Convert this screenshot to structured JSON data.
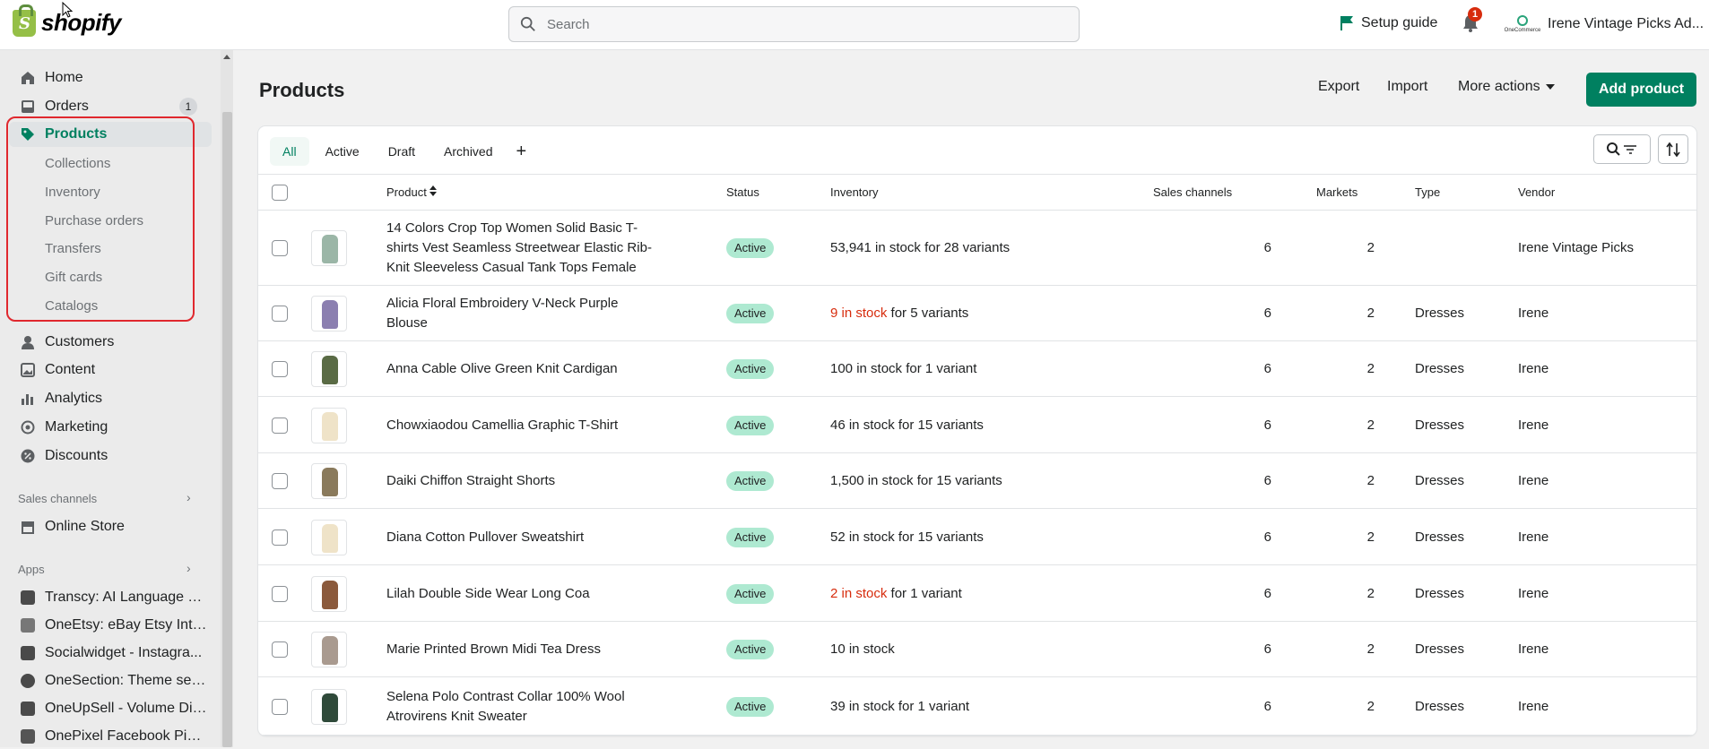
{
  "topbar": {
    "logo_text": "shopify",
    "search_placeholder": "Search",
    "setup_guide": "Setup guide",
    "notification_count": "1",
    "store_name": "Irene Vintage Picks Ad...",
    "store_logo_text": "OneCommerce"
  },
  "sidebar": {
    "home": "Home",
    "orders": "Orders",
    "orders_badge": "1",
    "products": "Products",
    "sub_items": [
      "Collections",
      "Inventory",
      "Purchase orders",
      "Transfers",
      "Gift cards",
      "Catalogs"
    ],
    "customers": "Customers",
    "content": "Content",
    "analytics": "Analytics",
    "marketing": "Marketing",
    "discounts": "Discounts",
    "sales_channels_label": "Sales channels",
    "online_store": "Online Store",
    "apps_label": "Apps",
    "apps": [
      "Transcy: AI Language Tr...",
      "OneEtsy: eBay Etsy Inte...",
      "Socialwidget - Instagra...",
      "OneSection: Theme sec...",
      "OneUpSell - Volume Dis...",
      "OnePixel Facebook Pixe..."
    ]
  },
  "page": {
    "title": "Products",
    "export": "Export",
    "import": "Import",
    "more_actions": "More actions",
    "add_product": "Add product"
  },
  "tabs": [
    "All",
    "Active",
    "Draft",
    "Archived"
  ],
  "table": {
    "headers": {
      "product": "Product",
      "status": "Status",
      "inventory": "Inventory",
      "sales_channels": "Sales channels",
      "markets": "Markets",
      "type": "Type",
      "vendor": "Vendor"
    },
    "rows": [
      {
        "name": "14 Colors Crop Top Women Solid Basic T-shirts Vest Seamless Streetwear Elastic Rib-Knit Sleeveless Casual Tank Tops Female",
        "status": "Active",
        "inv_low": "",
        "inv": "53,941 in stock for 28 variants",
        "channels": "6",
        "markets": "2",
        "type": "",
        "vendor": "Irene Vintage Picks",
        "thumb_color": "#9bb6a7"
      },
      {
        "name": "Alicia Floral Embroidery V-Neck Purple Blouse",
        "status": "Active",
        "inv_low": "9 in stock",
        "inv": " for 5 variants",
        "channels": "6",
        "markets": "2",
        "type": "Dresses",
        "vendor": "Irene",
        "thumb_color": "#8b7fb0"
      },
      {
        "name": "Anna Cable Olive Green Knit Cardigan",
        "status": "Active",
        "inv_low": "",
        "inv": "100 in stock for 1 variant",
        "channels": "6",
        "markets": "2",
        "type": "Dresses",
        "vendor": "Irene",
        "thumb_color": "#5a6b45"
      },
      {
        "name": "Chowxiaodou Camellia Graphic T-Shirt",
        "status": "Active",
        "inv_low": "",
        "inv": "46 in stock for 15 variants",
        "channels": "6",
        "markets": "2",
        "type": "Dresses",
        "vendor": "Irene",
        "thumb_color": "#efe3c8"
      },
      {
        "name": "Daiki Chiffon Straight Shorts",
        "status": "Active",
        "inv_low": "",
        "inv": "1,500 in stock for 15 variants",
        "channels": "6",
        "markets": "2",
        "type": "Dresses",
        "vendor": "Irene",
        "thumb_color": "#8a7a5c"
      },
      {
        "name": "Diana Cotton Pullover Sweatshirt",
        "status": "Active",
        "inv_low": "",
        "inv": "52 in stock for 15 variants",
        "channels": "6",
        "markets": "2",
        "type": "Dresses",
        "vendor": "Irene",
        "thumb_color": "#efe3c8"
      },
      {
        "name": "Lilah Double Side Wear Long Coa",
        "status": "Active",
        "inv_low": "2 in stock",
        "inv": " for 1 variant",
        "channels": "6",
        "markets": "2",
        "type": "Dresses",
        "vendor": "Irene",
        "thumb_color": "#8b5a3c"
      },
      {
        "name": "Marie Printed Brown Midi Tea Dress",
        "status": "Active",
        "inv_low": "",
        "inv": "10 in stock",
        "channels": "6",
        "markets": "2",
        "type": "Dresses",
        "vendor": "Irene",
        "thumb_color": "#a99a8f"
      },
      {
        "name": "Selena Polo Contrast Collar 100% Wool Atrovirens Knit Sweater",
        "status": "Active",
        "inv_low": "",
        "inv": "39 in stock for 1 variant",
        "channels": "6",
        "markets": "2",
        "type": "Dresses",
        "vendor": "Irene",
        "thumb_color": "#2f4a3a"
      }
    ]
  },
  "colors": {
    "accent": "#008060",
    "badge_active": "#aee9d1",
    "low_stock": "#d72c0d",
    "highlight": "#e0282e"
  }
}
